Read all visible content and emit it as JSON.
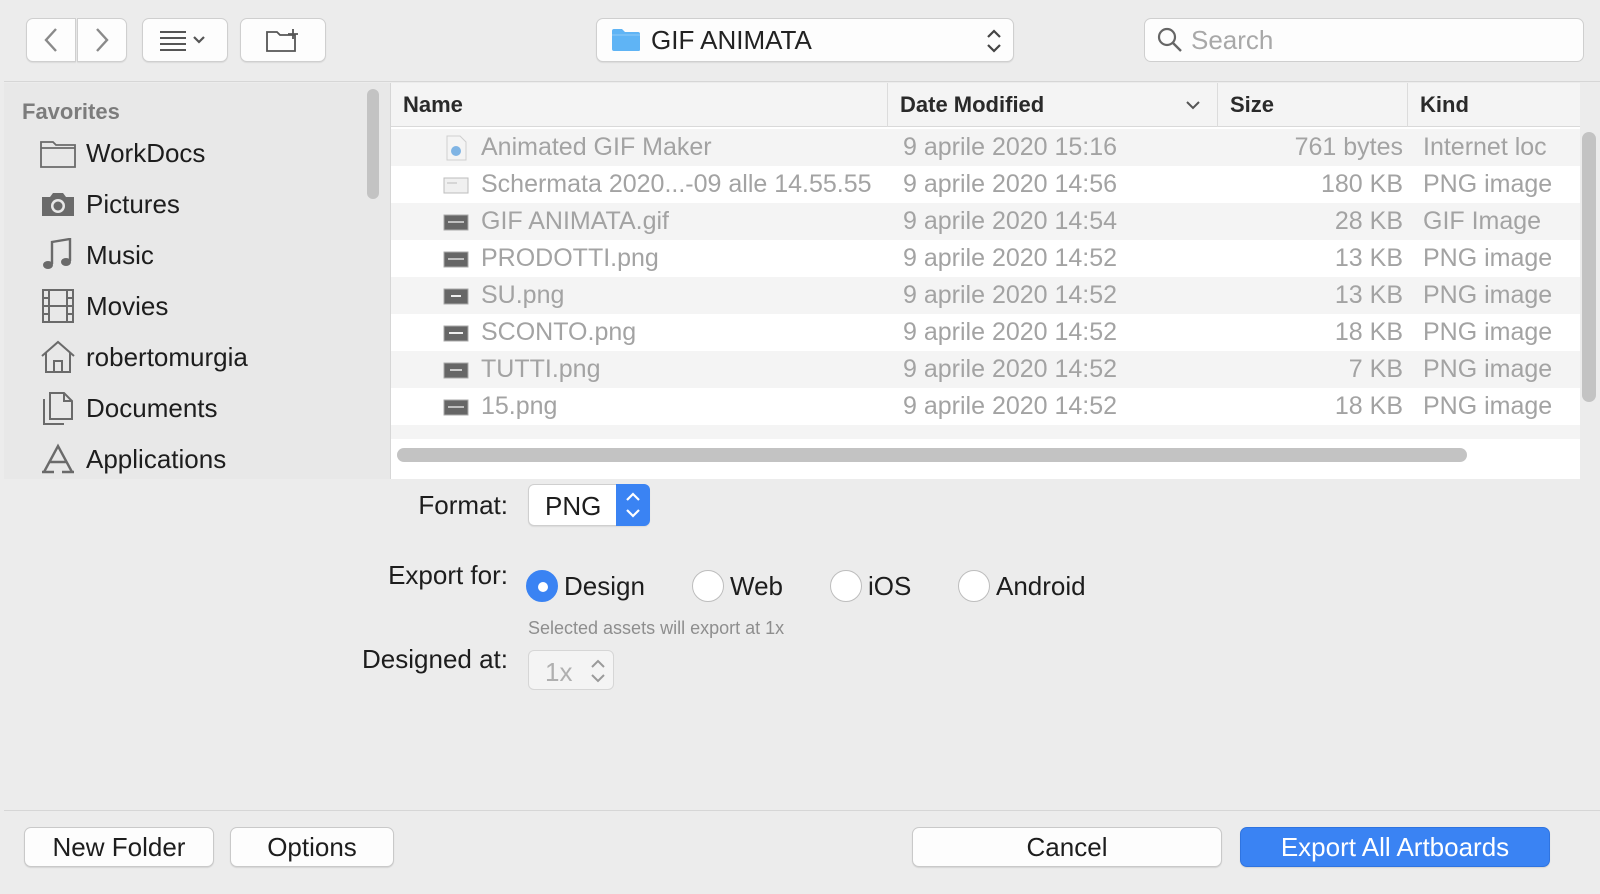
{
  "toolbar": {
    "back_icon": "chevron-left-icon",
    "forward_icon": "chevron-right-icon",
    "view_icon": "list-view-icon",
    "new_folder_icon": "new-folder-icon",
    "location": "GIF ANIMATA",
    "search_placeholder": "Search"
  },
  "sidebar": {
    "section": "Favorites",
    "items": [
      {
        "label": "WorkDocs",
        "icon": "folder-icon"
      },
      {
        "label": "Pictures",
        "icon": "camera-icon"
      },
      {
        "label": "Music",
        "icon": "music-note-icon"
      },
      {
        "label": "Movies",
        "icon": "film-icon"
      },
      {
        "label": "robertomurgia",
        "icon": "home-icon"
      },
      {
        "label": "Documents",
        "icon": "documents-icon"
      },
      {
        "label": "Applications",
        "icon": "applications-icon"
      }
    ]
  },
  "filelist": {
    "columns": {
      "name": "Name",
      "date": "Date Modified",
      "size": "Size",
      "kind": "Kind"
    },
    "rows": [
      {
        "name": "Animated GIF Maker",
        "date": "9 aprile 2020 15:16",
        "size": "761 bytes",
        "kind": "Internet loc"
      },
      {
        "name": "Schermata 2020...-09 alle 14.55.55",
        "date": "9 aprile 2020 14:56",
        "size": "180 KB",
        "kind": "PNG image"
      },
      {
        "name": "GIF ANIMATA.gif",
        "date": "9 aprile 2020 14:54",
        "size": "28 KB",
        "kind": "GIF Image"
      },
      {
        "name": "PRODOTTI.png",
        "date": "9 aprile 2020 14:52",
        "size": "13 KB",
        "kind": "PNG image"
      },
      {
        "name": "SU.png",
        "date": "9 aprile 2020 14:52",
        "size": "13 KB",
        "kind": "PNG image"
      },
      {
        "name": "SCONTO.png",
        "date": "9 aprile 2020 14:52",
        "size": "18 KB",
        "kind": "PNG image"
      },
      {
        "name": "TUTTI.png",
        "date": "9 aprile 2020 14:52",
        "size": "7 KB",
        "kind": "PNG image"
      },
      {
        "name": "15.png",
        "date": "9 aprile 2020 14:52",
        "size": "18 KB",
        "kind": "PNG image"
      }
    ]
  },
  "options": {
    "format_label": "Format:",
    "format_value": "PNG",
    "export_for_label": "Export for:",
    "export_for": [
      {
        "label": "Design",
        "selected": true
      },
      {
        "label": "Web",
        "selected": false
      },
      {
        "label": "iOS",
        "selected": false
      },
      {
        "label": "Android",
        "selected": false
      }
    ],
    "hint": "Selected assets will export at 1x",
    "designed_at_label": "Designed at:",
    "designed_at_value": "1x"
  },
  "buttons": {
    "new_folder": "New Folder",
    "options": "Options",
    "cancel": "Cancel",
    "export": "Export All Artboards"
  },
  "colors": {
    "accent": "#3a83f3",
    "folder": "#5fb4f5"
  }
}
